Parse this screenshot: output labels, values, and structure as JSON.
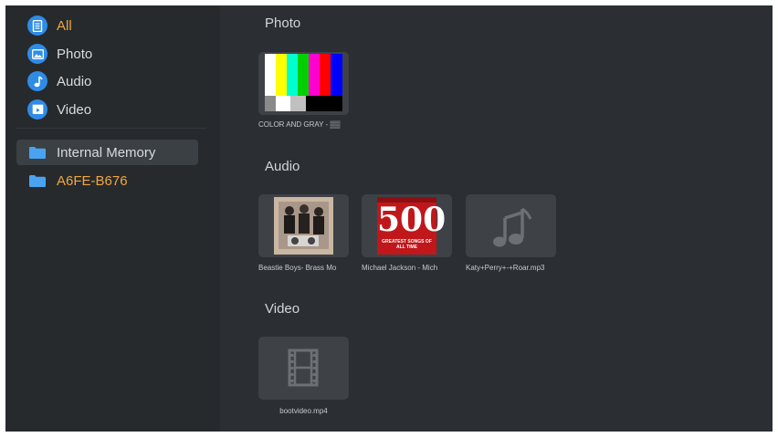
{
  "sidebar": {
    "categories": [
      {
        "label": "All",
        "icon": "document-icon",
        "active": true
      },
      {
        "label": "Photo",
        "icon": "image-icon",
        "active": false
      },
      {
        "label": "Audio",
        "icon": "music-note-icon",
        "active": false
      },
      {
        "label": "Video",
        "icon": "video-icon",
        "active": false
      }
    ],
    "storage": [
      {
        "label": "Internal Memory",
        "icon": "folder-icon",
        "selected": true
      },
      {
        "label": "A6FE-B676",
        "icon": "folder-icon",
        "selected": false
      }
    ]
  },
  "sections": {
    "photo": {
      "title": "Photo",
      "items": [
        {
          "label": "COLOR AND GRAY - ▒▒",
          "thumb": "color-bars"
        }
      ]
    },
    "audio": {
      "title": "Audio",
      "items": [
        {
          "label": "Beastie Boys- Brass Mo",
          "thumb": "album-art-photo"
        },
        {
          "label": "Michael Jackson - Mich",
          "thumb": "album-art-500",
          "art_text": "500",
          "art_subtext": "GREATEST SONGS OF ALL TIME"
        },
        {
          "label": "Katy+Perry+-+Roar.mp3",
          "thumb": "music-note-icon"
        }
      ]
    },
    "video": {
      "title": "Video",
      "items": [
        {
          "label": "bootvideo.mp4",
          "thumb": "film-icon"
        }
      ]
    }
  },
  "colors": {
    "background": "#2b2f33",
    "sidebar": "#262a2d",
    "accent": "#f0a640",
    "icon_blue": "#2f8ce6",
    "folder_blue": "#4aa3f0"
  }
}
